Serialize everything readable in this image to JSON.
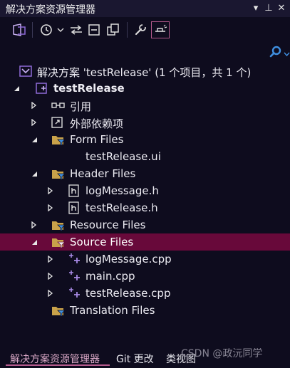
{
  "window": {
    "title": "解决方案资源管理器",
    "dropdown_glyph": "▾",
    "pin_glyph": "⊥",
    "close_glyph": "✕"
  },
  "tree": {
    "solution_label": "解决方案 'testRelease' (1 个项目，共 1 个)",
    "project_label": "testRelease",
    "references_label": "引用",
    "external_deps_label": "外部依赖项",
    "form_files_label": "Form Files",
    "form_ui_file": "testRelease.ui",
    "header_files_label": "Header Files",
    "header_1": "logMessage.h",
    "header_2": "testRelease.h",
    "resource_files_label": "Resource Files",
    "source_files_label": "Source Files",
    "source_1": "logMessage.cpp",
    "source_2": "main.cpp",
    "source_3": "testRelease.cpp",
    "translation_files_label": "Translation Files"
  },
  "bottom_tabs": {
    "solution_explorer": "解决方案资源管理器",
    "git_changes": "Git 更改",
    "class_view": "类视图"
  },
  "watermark": "CSDN @政沅同学",
  "colors": {
    "background": "#0e0c1e",
    "selection": "#68093a",
    "folder": "#c9a24a",
    "filter": "#3f8fe0",
    "vs_purple": "#8f6bd8"
  }
}
